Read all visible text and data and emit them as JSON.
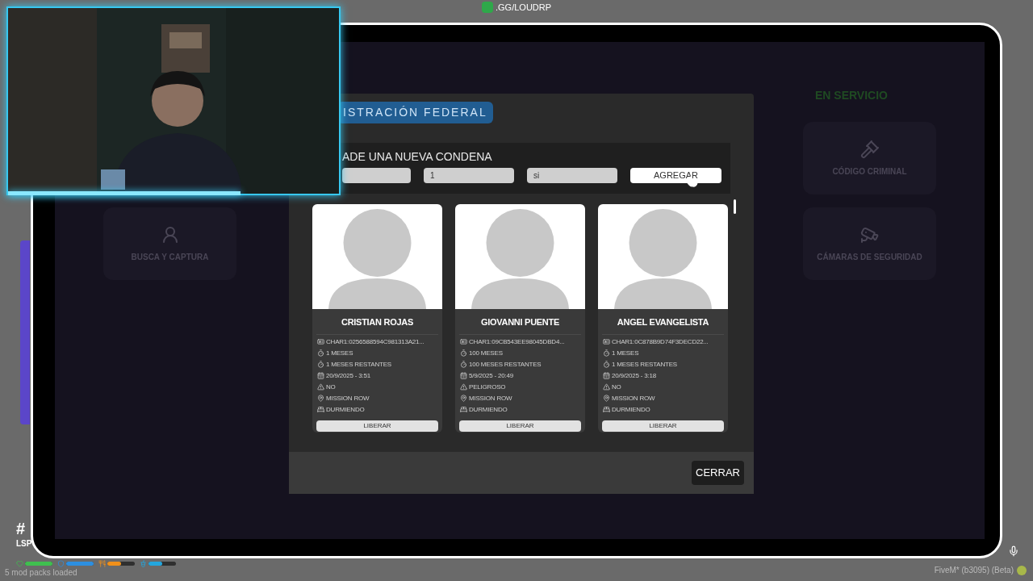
{
  "top_label": {
    "text": ".GG/LOUDRP"
  },
  "background_app": {
    "status": "EN SERVICIO",
    "left_tiles": [
      {
        "kind": "wanted",
        "label": "BUSCA Y CAPTURA"
      }
    ],
    "right_tiles": [
      {
        "kind": "law",
        "label": "CÓDIGO CRIMINAL"
      },
      {
        "kind": "camera",
        "label": "CÁMARAS DE SEGURIDAD"
      }
    ]
  },
  "modal": {
    "title": "ISTRACIÓN FEDERAL",
    "section_title": "ADE UNA NUEVA CONDENA",
    "fields": [
      {
        "kind": "input"
      },
      {
        "kind": "input",
        "value": "1"
      },
      {
        "kind": "input",
        "value": "si"
      }
    ],
    "add_button": "AGREGAR",
    "prisoners": [
      {
        "name": "CRISTIAN ROJAS",
        "action": "LIBERAR",
        "info": [
          {
            "kind": "id",
            "text": "CHAR1:0256588594C981313A21..."
          },
          {
            "kind": "time",
            "text": "1 MESES"
          },
          {
            "kind": "time",
            "text": "1 MESES RESTANTES"
          },
          {
            "kind": "date",
            "text": "20/9/2025 - 3:51"
          },
          {
            "kind": "danger",
            "text": "NO"
          },
          {
            "kind": "location",
            "text": "MISSION ROW"
          },
          {
            "kind": "sleep",
            "text": "DURMIENDO"
          }
        ]
      },
      {
        "name": "GIOVANNI PUENTE",
        "action": "LIBERAR",
        "info": [
          {
            "kind": "id",
            "text": "CHAR1:09CB543EE98045DBD4..."
          },
          {
            "kind": "time",
            "text": "100 MESES"
          },
          {
            "kind": "time",
            "text": "100 MESES RESTANTES"
          },
          {
            "kind": "date",
            "text": "5/9/2025 - 20:49"
          },
          {
            "kind": "danger",
            "text": "PELIGROSO"
          },
          {
            "kind": "location",
            "text": "MISSION ROW"
          },
          {
            "kind": "sleep",
            "text": "DURMIENDO"
          }
        ]
      },
      {
        "name": "ANGEL EVANGELISTA",
        "action": "LIBERAR",
        "info": [
          {
            "kind": "id",
            "text": "CHAR1:0C878B9D74F3DECD22..."
          },
          {
            "kind": "time",
            "text": "1 MESES"
          },
          {
            "kind": "time",
            "text": "1 MESES RESTANTES"
          },
          {
            "kind": "date",
            "text": "20/9/2025 - 3:18"
          },
          {
            "kind": "danger",
            "text": "NO"
          },
          {
            "kind": "location",
            "text": "MISSION ROW"
          },
          {
            "kind": "sleep",
            "text": "DURMIENDO"
          }
        ]
      }
    ],
    "close_button": "CERRAR"
  },
  "hud": {
    "player_tag": "#",
    "player_sub": "LSP",
    "status_text": "5 mod packs loaded",
    "version": "FiveM* (b3095) (Beta)",
    "bars": [
      {
        "kind": "health",
        "level": 1
      },
      {
        "kind": "armor",
        "level": 1
      },
      {
        "kind": "food",
        "level": 0.5
      },
      {
        "kind": "water",
        "level": 0.5
      }
    ]
  }
}
